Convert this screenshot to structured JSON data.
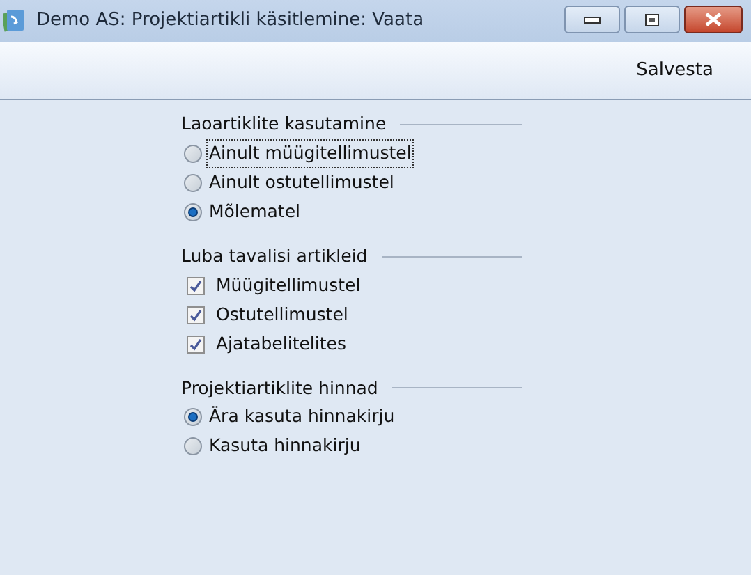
{
  "window": {
    "title": "Demo AS: Projektiartikli käsitlemine: Vaata"
  },
  "toolbar": {
    "buttons": [
      "Salvesta"
    ]
  },
  "groups": [
    {
      "title": "Laoartiklite kasutamine",
      "kind": "radio",
      "items": [
        {
          "label": "Ainult müügitellimustel",
          "selected": false,
          "focused": true
        },
        {
          "label": "Ainult ostutellimustel",
          "selected": false,
          "focused": false
        },
        {
          "label": "Mõlematel",
          "selected": true,
          "focused": false
        }
      ]
    },
    {
      "title": "Luba tavalisi artikleid",
      "kind": "checkbox",
      "items": [
        {
          "label": "Müügitellimustel",
          "checked": true
        },
        {
          "label": "Ostutellimustel",
          "checked": true
        },
        {
          "label": "Ajatabelitelites",
          "checked": true
        }
      ]
    },
    {
      "title": "Projektiartiklite hinnad",
      "kind": "radio",
      "items": [
        {
          "label": "Ära kasuta hinnakirju",
          "selected": true,
          "focused": false
        },
        {
          "label": "Kasuta hinnakirju",
          "selected": false,
          "focused": false
        }
      ]
    }
  ]
}
